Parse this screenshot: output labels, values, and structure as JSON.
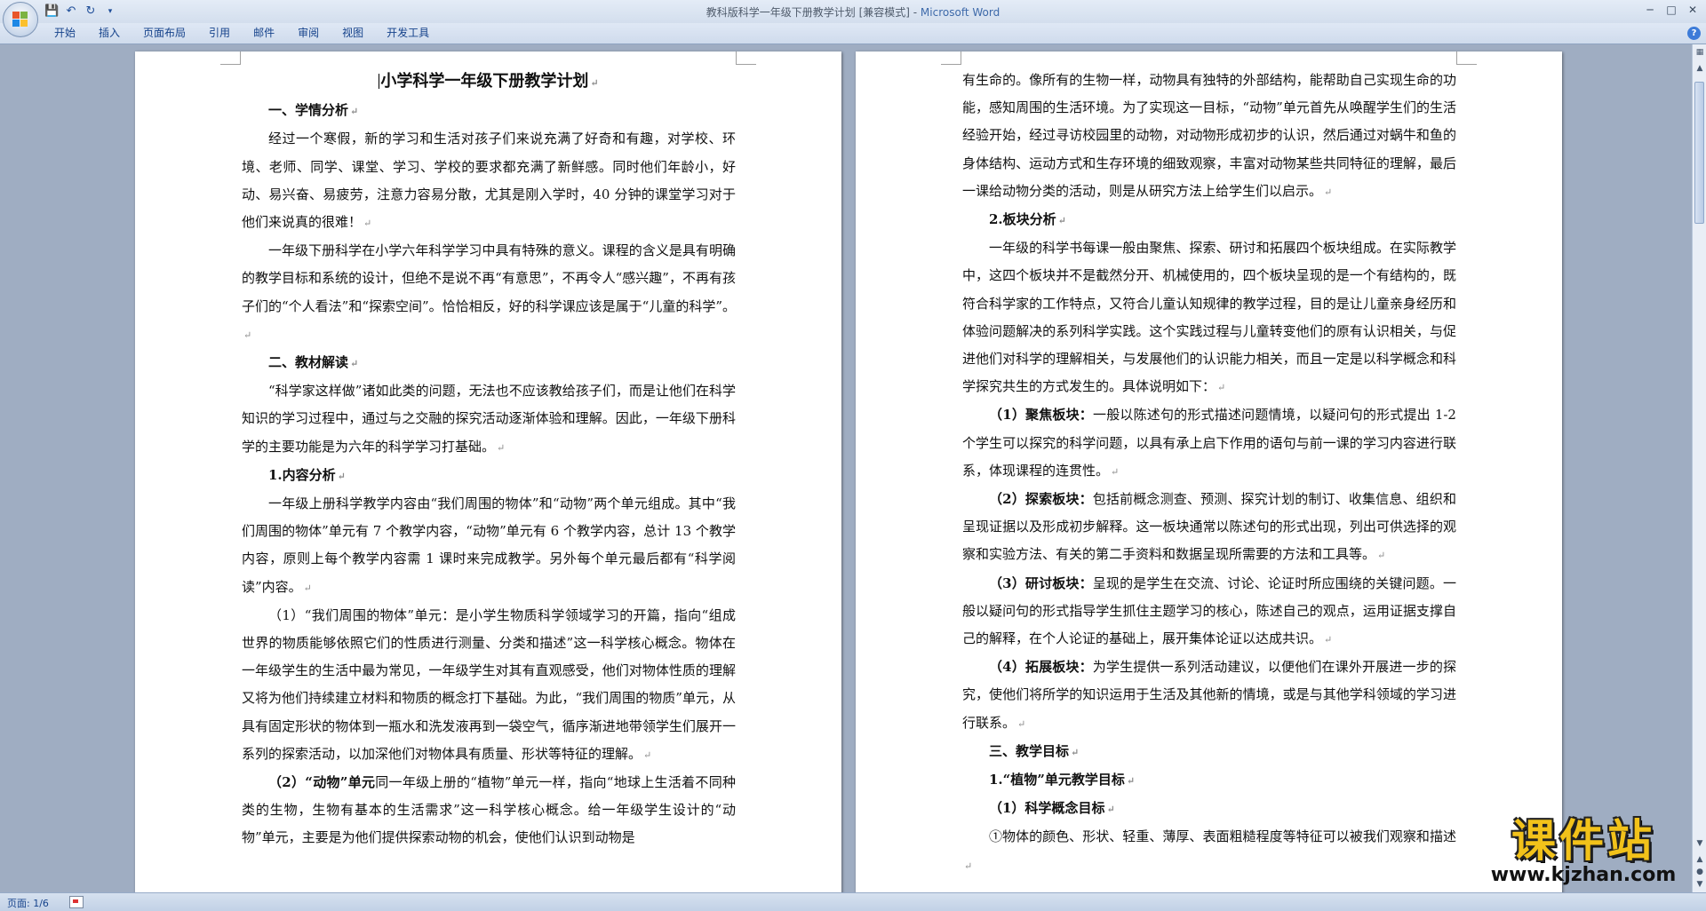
{
  "window": {
    "title": "教科版科学一年级下册教学计划 [兼容模式] - ",
    "app_name": "Microsoft Word",
    "controls": [
      "─",
      "□",
      "✕"
    ]
  },
  "qat": {
    "icons": [
      "save-icon",
      "undo-icon",
      "redo-icon",
      "customize-icon"
    ]
  },
  "ribbon": {
    "tabs": [
      "开始",
      "插入",
      "页面布局",
      "引用",
      "邮件",
      "审阅",
      "视图",
      "开发工具"
    ],
    "help": "?"
  },
  "document": {
    "page1": {
      "title": "小学科学一年级下册教学计划",
      "s1_heading": "一、学情分析",
      "p1": "经过一个寒假，新的学习和生活对孩子们来说充满了好奇和有趣，对学校、环境、老师、同学、课堂、学习、学校的要求都充满了新鲜感。同时他们年龄小，好动、易兴奋、易疲劳，注意力容易分散，尤其是刚入学时，40 分钟的课堂学习对于他们来说真的很难！",
      "p2": "一年级下册科学在小学六年科学学习中具有特殊的意义。课程的含义是具有明确的教学目标和系统的设计，但绝不是说不再“有意思”，不再令人“感兴趣”，不再有孩子们的“个人看法”和“探索空间”。恰恰相反，好的科学课应该是属于“儿童的科学”。",
      "s2_heading": "二、教材解读",
      "p3": "“科学家这样做”诸如此类的问题，无法也不应该教给孩子们，而是让他们在科学知识的学习过程中，通过与之交融的探究活动逐渐体验和理解。因此，一年级下册科学的主要功能是为六年的科学学习打基础。",
      "s3_heading": "1.内容分析",
      "p4": "一年级上册科学教学内容由“我们周围的物体”和“动物”两个单元组成。其中“我们周围的物体”单元有 7 个教学内容，“动物”单元有 6 个教学内容，总计 13 个教学内容，原则上每个教学内容需 1 课时来完成教学。另外每个单元最后都有“科学阅读”内容。",
      "p5": "（1）“我们周围的物体”单元：是小学生物质科学领域学习的开篇，指向“组成世界的物质能够依照它们的性质进行测量、分类和描述”这一科学核心概念。物体在一年级学生的生活中最为常见，一年级学生对其有直观感受，他们对物体性质的理解又将为他们持续建立材料和物质的概念打下基础。为此，“我们周围的物质”单元，从具有固定形状的物体到一瓶水和洗发液再到一袋空气，循序渐进地带领学生们展开一系列的探索活动，以加深他们对物体具有质量、形状等特征的理解。",
      "p6_lead": "（2）“动物”单元",
      "p6": "同一年级上册的“植物”单元一样，指向“地球上生活着不同种类的生物，生物有基本的生活需求”这一科学核心概念。给一年级学生设计的“动物”单元，主要是为他们提供探索动物的机会，使他们认识到动物是"
    },
    "page2": {
      "p1": "有生命的。像所有的生物一样，动物具有独特的外部结构，能帮助自己实现生命的功能，感知周围的生活环境。为了实现这一目标，“动物”单元首先从唤醒学生们的生活经验开始，经过寻访校园里的动物，对动物形成初步的认识，然后通过对蜗牛和鱼的身体结构、运动方式和生存环境的细致观察，丰富对动物某些共同特征的理解，最后一课给动物分类的活动，则是从研究方法上给学生们以启示。",
      "s1_heading": "2.板块分析",
      "p2": "一年级的科学书每课一般由聚焦、探索、研讨和拓展四个板块组成。在实际教学中，这四个板块并不是截然分开、机械使用的，四个板块呈现的是一个有结构的，既符合科学家的工作特点，又符合儿童认知规律的教学过程，目的是让儿童亲身经历和体验问题解决的系列科学实践。这个实践过程与儿童转变他们的原有认识相关，与促进他们对科学的理解相关，与发展他们的认识能力相关，而且一定是以科学概念和科学探究共生的方式发生的。具体说明如下：",
      "i1_lead": "（1）聚焦板块：",
      "i1": "一般以陈述句的形式描述问题情境，以疑问句的形式提出 1-2 个学生可以探究的科学问题，以具有承上启下作用的语句与前一课的学习内容进行联系，体现课程的连贯性。",
      "i2_lead": "（2）探索板块：",
      "i2": "包括前概念测查、预测、探究计划的制订、收集信息、组织和呈现证据以及形成初步解释。这一板块通常以陈述句的形式出现，列出可供选择的观察和实验方法、有关的第二手资料和数据呈现所需要的方法和工具等。",
      "i3_lead": "（3）研讨板块：",
      "i3": "呈现的是学生在交流、讨论、论证时所应围绕的关键问题。一般以疑问句的形式指导学生抓住主题学习的核心，陈述自己的观点，运用证据支撑自己的解释，在个人论证的基础上，展开集体论证以达成共识。",
      "i4_lead": "（4）拓展板块：",
      "i4": "为学生提供一系列活动建议，以便他们在课外开展进一步的探究，使他们将所学的知识运用于生活及其他新的情境，或是与其他学科领域的学习进行联系。",
      "s2_heading": "三、教学目标",
      "s3_heading": "1.“植物”单元教学目标",
      "s4_heading": "（1）科学概念目标",
      "p3": "①物体的颜色、形状、轻重、薄厚、表面粗糙程度等特征可以被我们观察和描述"
    }
  },
  "status": {
    "page_count": "页面: 1/6"
  },
  "watermark": {
    "text": "课件站",
    "url": "www.kjzhan.com"
  }
}
